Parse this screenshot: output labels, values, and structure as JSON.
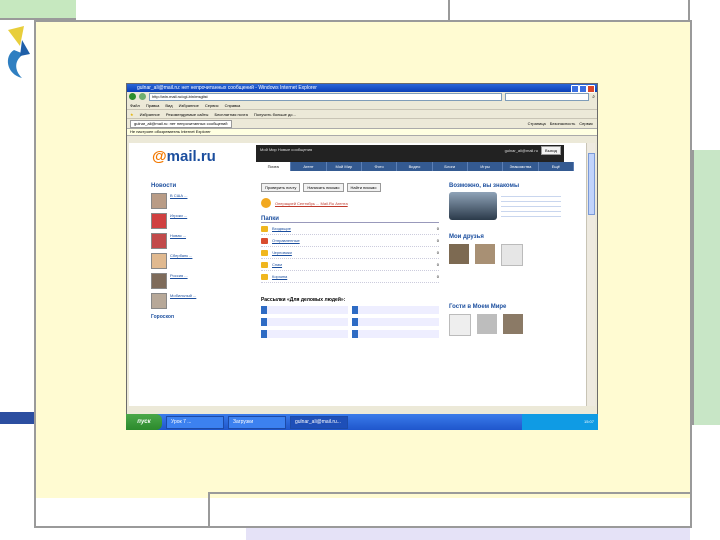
{
  "browser": {
    "title": "gulnar_ali@mail.ru: нет непрочитанных сообщений - Windows Internet Explorer",
    "address": "http://win.mail.ru/cgi-bin/msglist",
    "menu": [
      "Файл",
      "Правка",
      "Вид",
      "Избранное",
      "Сервис",
      "Справка"
    ],
    "links": [
      "Избранное",
      "Рекомендуемые сайты",
      "Бесплатная почта",
      "Получить больше до..."
    ],
    "tab": "gulnar_ali@mail.ru: нет непрочитанных сообщений",
    "tools": [
      "Страница",
      "Безопасность",
      "Сервис"
    ],
    "infobar": "Не настроен обозреватель Internet Explorer"
  },
  "mail": {
    "logo_prefix": "@",
    "logo_name": "mail.ru",
    "promo": "Мой Мир  Новые сообщения",
    "user": "gulnar_ali@mail.ru",
    "exit_label": "Выход",
    "nav": [
      "Почта",
      "Агент",
      "Мой Мир",
      "Фото",
      "Видео",
      "Блоги",
      "Игры",
      "Знакомства",
      "Ещё"
    ],
    "left": {
      "news_header": "Новости",
      "news": [
        "В США ...",
        "Игроки ...",
        "Новая ...",
        "Сбербанк ...",
        "Россия ...",
        "Мобильный ..."
      ],
      "horoscope": "Гороскоп"
    },
    "middle": {
      "buttons": [
        "Проверить почту",
        "Написать письмо",
        "Найти письмо"
      ],
      "promo_line": "Операцией Сентябрь ... Mail.Ru Агента",
      "folders_header": "Папки",
      "folders": [
        {
          "name": "Входящие",
          "count": "0"
        },
        {
          "name": "Отправленные",
          "count": "0"
        },
        {
          "name": "Черновики",
          "count": "0"
        },
        {
          "name": "Спам",
          "count": "0"
        },
        {
          "name": "Корзина",
          "count": "0"
        }
      ],
      "mailings_header": "Рассылки «Для деловых людей»:"
    },
    "right": {
      "dating_header": "Возможно, вы знакомы",
      "friends_header": "Мои друзья",
      "guests_header": "Гости в Моем Мире"
    }
  },
  "taskbar": {
    "start": "пуск",
    "items": [
      "Урок 7 ...",
      "Загрузки",
      "gulnar_ali@mail.ru..."
    ],
    "time": "15:07"
  }
}
